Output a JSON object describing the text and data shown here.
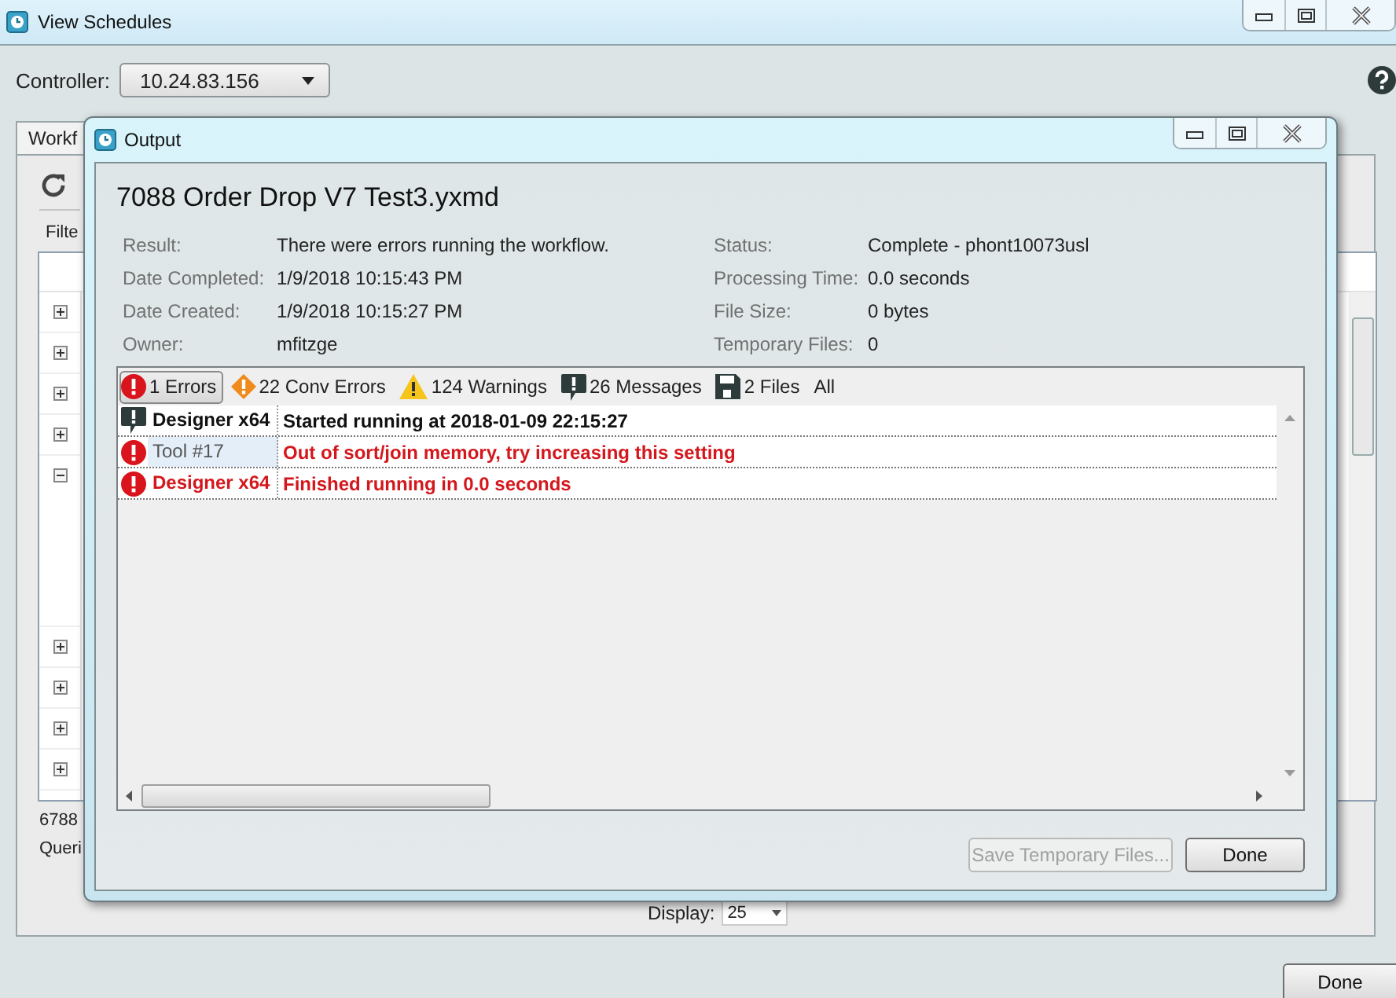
{
  "window": {
    "title": "View Schedules"
  },
  "controller": {
    "label": "Controller:",
    "value": "10.24.83.156"
  },
  "tabs": [
    {
      "label": "Workf",
      "selected": true
    }
  ],
  "filter_label": "Filte",
  "grid_rows": [
    {
      "expanded": false
    },
    {
      "expanded": false
    },
    {
      "expanded": false
    },
    {
      "expanded": false
    },
    {
      "expanded": true
    },
    {
      "expanded": false
    },
    {
      "expanded": false
    },
    {
      "expanded": false
    },
    {
      "expanded": false
    }
  ],
  "footer_texts": [
    "6788",
    "Queri"
  ],
  "display": {
    "label": "Display:",
    "value": "25"
  },
  "done_button": "Done",
  "dialog": {
    "title": "Output",
    "heading": "7088 Order Drop V7 Test3.yxmd",
    "details_left": [
      {
        "label": "Result:",
        "value": "There were errors running the workflow."
      },
      {
        "label": "Date Completed:",
        "value": "1/9/2018 10:15:43 PM"
      },
      {
        "label": "Date Created:",
        "value": "1/9/2018 10:15:27 PM"
      },
      {
        "label": "Owner:",
        "value": "mfitzge"
      }
    ],
    "details_right": [
      {
        "label": "Status:",
        "value": "Complete - phont10073usl"
      },
      {
        "label": "Processing Time:",
        "value": "0.0 seconds"
      },
      {
        "label": "File Size:",
        "value": "0 bytes"
      },
      {
        "label": "Temporary Files:",
        "value": "0"
      }
    ],
    "filters": [
      {
        "kind": "error",
        "label": "1 Errors",
        "selected": true
      },
      {
        "kind": "conv_error",
        "label": "22 Conv Errors",
        "selected": false
      },
      {
        "kind": "warning",
        "label": "124 Warnings",
        "selected": false
      },
      {
        "kind": "message",
        "label": "26 Messages",
        "selected": false
      },
      {
        "kind": "file",
        "label": "2 Files",
        "selected": false
      },
      {
        "kind": "all",
        "label": "All",
        "selected": false
      }
    ],
    "messages": [
      {
        "kind": "message",
        "source": "Designer x64",
        "text": "Started running at 2018-01-09 22:15:27",
        "selected": false
      },
      {
        "kind": "error",
        "source": "Tool #17",
        "text": "Out of sort/join memory, try increasing this setting",
        "selected": true
      },
      {
        "kind": "error",
        "source": "Designer x64",
        "text": "Finished running in 0.0 seconds",
        "selected": false
      }
    ],
    "buttons": [
      {
        "label": "Save Temporary Files...",
        "disabled": true
      },
      {
        "label": "Done",
        "disabled": false
      }
    ]
  }
}
